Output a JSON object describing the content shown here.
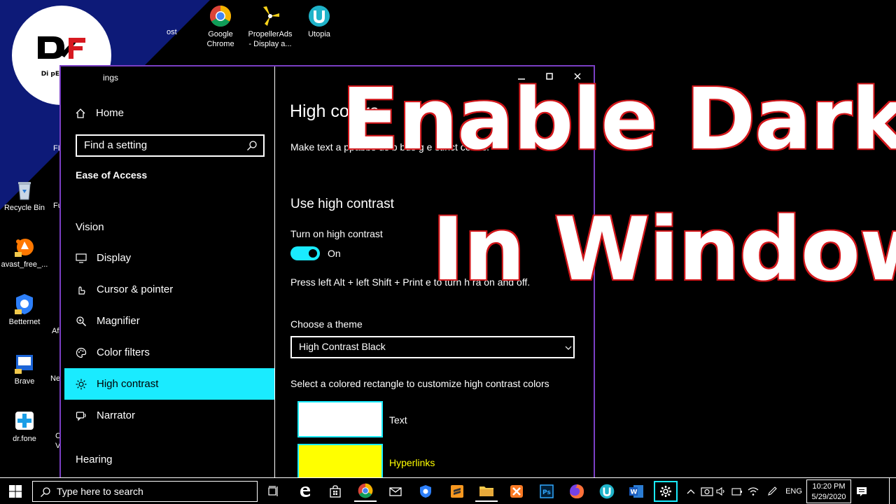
{
  "logo": {
    "text": "Di pEn Tech"
  },
  "desktop_icons": [
    {
      "label": "Google\nChrome"
    },
    {
      "label": "PropellerAds\n- Display a..."
    },
    {
      "label": "Utopia"
    },
    {
      "label": "Recycle Bin"
    },
    {
      "label": "avast_free_..."
    },
    {
      "label": "Betternet"
    },
    {
      "label": "Brave"
    },
    {
      "label": "dr.fone"
    }
  ],
  "desktop_partial": [
    "ost",
    "FL",
    "Fu",
    "Af",
    "Ne",
    "C",
    "V"
  ],
  "settings": {
    "window_title": "ings",
    "home_label": "Home",
    "search_placeholder": "Find a setting",
    "section": "Ease of Access",
    "group_vision": "Vision",
    "group_hearing": "Hearing",
    "nav": [
      {
        "label": "Display",
        "icon": "monitor-icon"
      },
      {
        "label": "Cursor & pointer",
        "icon": "pointer-icon"
      },
      {
        "label": "Magnifier",
        "icon": "magnifier-icon"
      },
      {
        "label": "Color filters",
        "icon": "palette-icon"
      },
      {
        "label": "High contrast",
        "icon": "sun-icon",
        "active": true
      },
      {
        "label": "Narrator",
        "icon": "narrator-icon"
      }
    ],
    "page_title": "High contra",
    "description": "Make text a    ppabbs   us    b bus   g  e   stinct colors.",
    "use_heading": "Use high contrast",
    "toggle_label": "Turn on high contrast",
    "toggle_state": "On",
    "shortcut_text": "Press left Alt + left Shift + Print       e   to turn h       ra       on and off.",
    "theme_label": "Choose a theme",
    "theme_value": "High Contrast Black",
    "customize_text": "Select a colored rectangle to customize high contrast colors",
    "swatches": [
      {
        "label": "Text",
        "color": "#ffffff",
        "label_color": "#ffffff"
      },
      {
        "label": "Hyperlinks",
        "color": "#ffff00",
        "label_color": "#ffff00"
      }
    ]
  },
  "overlay": {
    "line1": "Enable Dark Mode",
    "line2": "In Windows",
    "fill": "#ffffff",
    "outline": "#d2171b"
  },
  "taskbar": {
    "search_placeholder": "Type here to search",
    "language": "ENG",
    "time": "10:20 PM",
    "date": "5/29/2020"
  },
  "colors": {
    "accent": "#1aebff",
    "window_border": "#7a3fc4",
    "navy": "#0d1a78"
  }
}
